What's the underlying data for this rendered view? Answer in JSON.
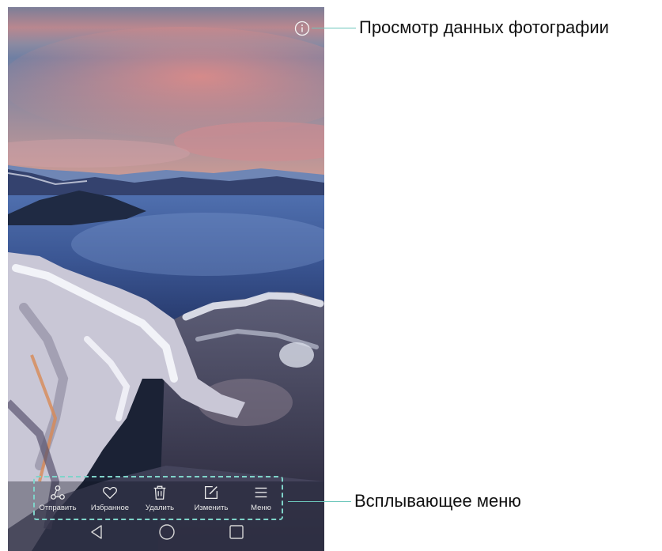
{
  "photo": {
    "description_icon": "info-icon"
  },
  "menu": {
    "items": [
      {
        "label": "Отправить",
        "icon": "share-icon"
      },
      {
        "label": "Избранное",
        "icon": "heart-icon"
      },
      {
        "label": "Удалить",
        "icon": "trash-icon"
      },
      {
        "label": "Изменить",
        "icon": "edit-icon"
      },
      {
        "label": "Меню",
        "icon": "menu-icon"
      }
    ]
  },
  "navbar": {
    "items": [
      {
        "icon": "back-icon"
      },
      {
        "icon": "home-icon"
      },
      {
        "icon": "recents-icon"
      }
    ]
  },
  "callouts": {
    "info": "Просмотр данных фотографии",
    "menu": "Всплывающее меню"
  },
  "colors": {
    "callout_line": "#6cc6bb",
    "menu_border": "#7fd3c9"
  }
}
